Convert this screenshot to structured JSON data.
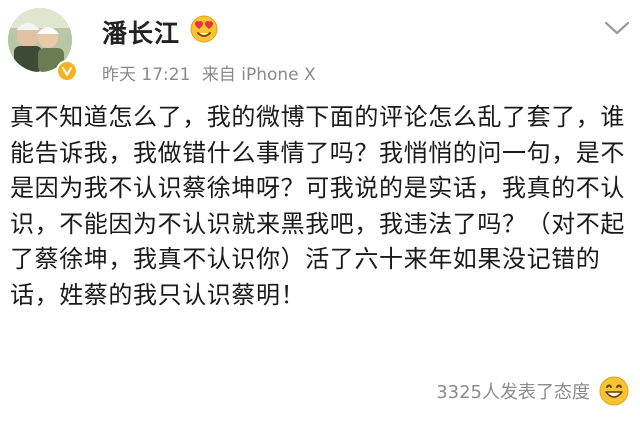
{
  "post": {
    "author": "潘长江",
    "timestamp": "昨天 17:21",
    "source": "来自 iPhone X",
    "text": "真不知道怎么了，我的微博下面的评论怎么乱了套了，谁能告诉我，我做错什么事情了吗？我悄悄的问一句，是不是因为我不认识蔡徐坤呀？可我说的是实话，我真的不认识，不能因为不认识就来黑我吧，我违法了吗？（对不起了蔡徐坤，我真不认识你）活了六十来年如果没记错的话，姓蔡的我只认识蔡明！",
    "reactions_text": "3325人发表了态度"
  },
  "icons": {
    "avatar": "avatar",
    "verified_badge": "verified-badge-icon",
    "name_emoji": "love-eyes-emoji-icon",
    "menu": "chevron-down-icon",
    "reaction": "smile-emoji-icon"
  },
  "colors": {
    "meta_text": "#8a8a8a",
    "badge": "#f5b321",
    "emoji": "#f7c533"
  }
}
